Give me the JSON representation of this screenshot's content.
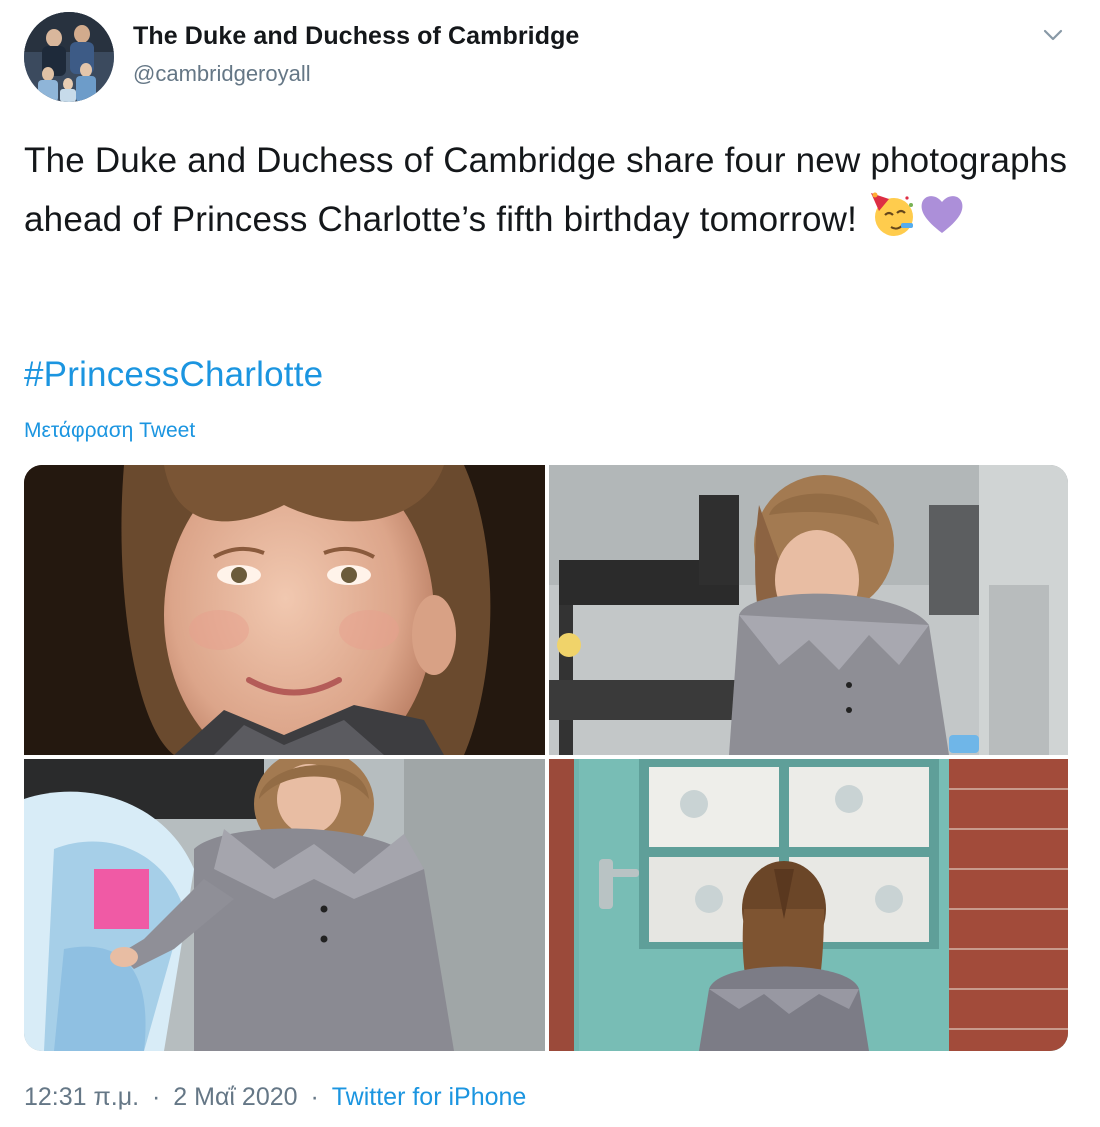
{
  "tweet": {
    "display_name": "The Duke and Duchess of Cambridge",
    "handle": "@cambridgeroyall",
    "text": "The Duke and Duchess of Cambridge share four new photographs ahead of Princess Charlotte’s fifth birthday tomorrow!",
    "emojis": [
      "partying-face-icon",
      "purple-heart-icon"
    ],
    "hashtag": "#PrincessCharlotte",
    "translate_label": "Μετάφραση Tweet",
    "time": "12:31 π.μ.",
    "separator": "·",
    "date": "2 Μαΐ 2020",
    "source": "Twitter for iPhone"
  },
  "colors": {
    "link": "#1b95e0",
    "secondary_text": "#657786",
    "primary_text": "#14171a",
    "purple_heart": "#ac8fd9"
  },
  "media": [
    {
      "name": "photo-charlotte-portrait"
    },
    {
      "name": "photo-charlotte-leaning"
    },
    {
      "name": "photo-charlotte-with-bag"
    },
    {
      "name": "photo-charlotte-at-door"
    }
  ]
}
